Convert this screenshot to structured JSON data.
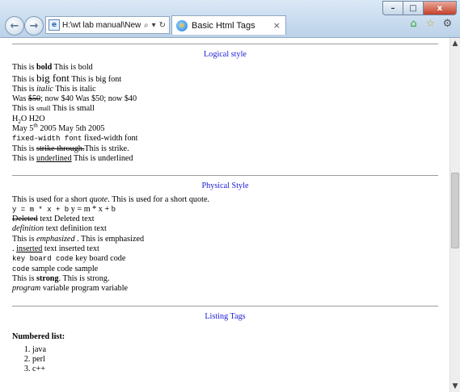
{
  "browser": {
    "address_text": "H:\\wt lab manual\\New folde",
    "address_search_icon": "⌕",
    "address_dropdown_icon": "▾",
    "address_refresh_icon": "↻",
    "tab_title": "Basic Html Tags",
    "tab_close": "×",
    "back_icon": "←",
    "forward_icon": "→",
    "home_icon": "⌂",
    "favorites_icon": "☆",
    "settings_icon": "⚙",
    "window_minimize": "–",
    "window_maximize": "□",
    "window_close": "x"
  },
  "logical": {
    "title": "Logical style",
    "bold": {
      "prefix": "This is ",
      "styled": "bold",
      "suffix": " This is bold"
    },
    "big": {
      "prefix": "This is ",
      "styled": "big font",
      "suffix": " This is big font"
    },
    "italic": {
      "prefix": "This is ",
      "styled": "italic",
      "suffix": " This is italic"
    },
    "del": {
      "prefix": "Was ",
      "styled": "$50",
      "suffix": "; now $40 Was $50; now $40"
    },
    "small": {
      "prefix": "This is ",
      "styled": "small",
      "suffix": " This is small"
    },
    "sub": {
      "pre": "H",
      "sub": "2",
      "post": "O H2O"
    },
    "sup": {
      "pre": "May 5",
      "sup": "th",
      "post": " 2005 May 5th 2005"
    },
    "tt": {
      "styled": "fixed-width font",
      "suffix": " fixed-width font"
    },
    "strike": {
      "prefix": "This is ",
      "styled": "strike through.",
      "suffix": "This is strike."
    },
    "underline": {
      "prefix": "This is ",
      "styled": "underlined",
      "suffix": " This is underlined"
    }
  },
  "physical": {
    "title": "Physical Style",
    "q": {
      "prefix": "This is used for a short ",
      "styled": "quote",
      "suffix": ". This is used for a short quote."
    },
    "var": {
      "styled": "y = m * x + b",
      "suffix": " y = m * x + b"
    },
    "deleted": {
      "styled": "Deleted",
      "suffix": " text Deleted text"
    },
    "dfn": {
      "styled": "definition",
      "suffix": " text definition text"
    },
    "em": {
      "prefix": "This is ",
      "styled": "emphasized",
      "suffix": " . This is emphasized"
    },
    "ins": {
      "prefix": ". ",
      "styled": "inserted",
      "suffix": " text inserted text"
    },
    "kbd": {
      "styled": "key board code",
      "suffix": " key board code"
    },
    "code": {
      "styled": "code",
      "suffix": " sample code sample"
    },
    "strong": {
      "prefix": "This is ",
      "styled": "strong",
      "suffix": ". This is strong."
    },
    "program": {
      "styled": "program",
      "suffix": " variable program variable"
    }
  },
  "listing": {
    "title": "Listing Tags",
    "numbered_heading": "Numbered list:",
    "items": [
      "java",
      "perl",
      "c++"
    ]
  },
  "scrollbar": {
    "up_icon": "▲",
    "down_icon": "▼"
  }
}
